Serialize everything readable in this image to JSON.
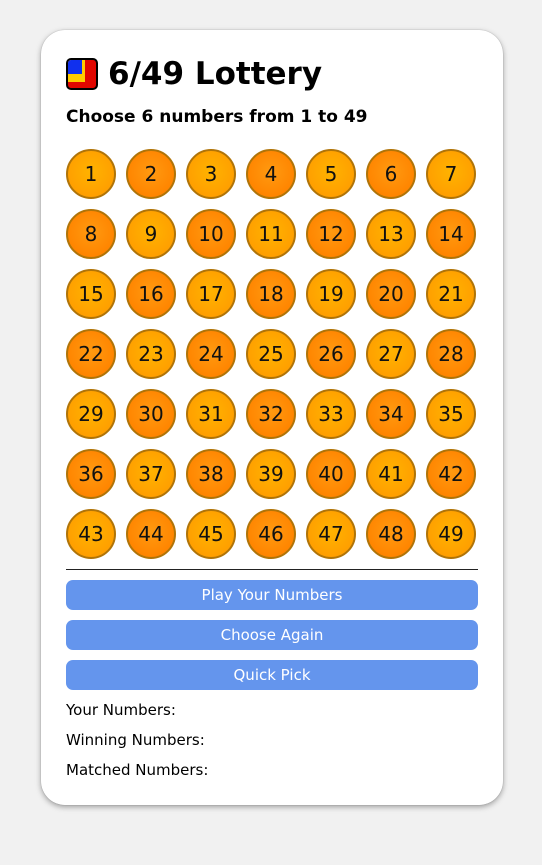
{
  "app": {
    "title": "6/49 Lottery",
    "subtitle": "Choose 6 numbers from 1 to 49",
    "logo_icon": "lottery-logo-icon"
  },
  "numbers": [
    "1",
    "2",
    "3",
    "4",
    "5",
    "6",
    "7",
    "8",
    "9",
    "10",
    "11",
    "12",
    "13",
    "14",
    "15",
    "16",
    "17",
    "18",
    "19",
    "20",
    "21",
    "22",
    "23",
    "24",
    "25",
    "26",
    "27",
    "28",
    "29",
    "30",
    "31",
    "32",
    "33",
    "34",
    "35",
    "36",
    "37",
    "38",
    "39",
    "40",
    "41",
    "42",
    "43",
    "44",
    "45",
    "46",
    "47",
    "48",
    "49"
  ],
  "buttons": {
    "play": "Play Your Numbers",
    "again": "Choose Again",
    "quick": "Quick Pick"
  },
  "results": {
    "your_label": "Your Numbers:",
    "winning_label": "Winning Numbers:",
    "matched_label": "Matched Numbers:"
  },
  "colors": {
    "background": "#f1f1f1",
    "card": "#ffffff",
    "ball_light": "#ff9f00",
    "ball_dark": "#ff8500",
    "ball_border": "#b07408",
    "button": "#6495ed",
    "button_text": "#ffffff"
  }
}
